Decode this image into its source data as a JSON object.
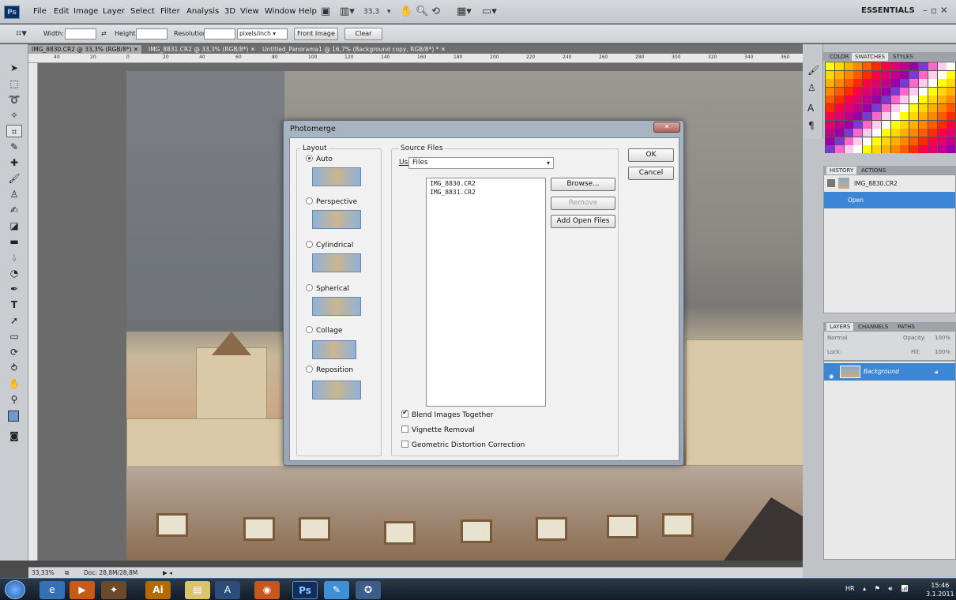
{
  "app": {
    "logo": "Ps",
    "workspace": "ESSENTIALS",
    "window_controls": "– ▫ ✕",
    "zoom": "33,3"
  },
  "menu": [
    "File",
    "Edit",
    "Image",
    "Layer",
    "Select",
    "Filter",
    "Analysis",
    "3D",
    "View",
    "Window",
    "Help"
  ],
  "options": {
    "width_label": "Width:",
    "height_label": "Height:",
    "resolution_label": "Resolution:",
    "units": "pixels/inch",
    "front_image": "Front Image",
    "clear": "Clear"
  },
  "tabs": [
    "IMG_8830.CR2 @ 33,3% (RGB/8*)",
    "IMG_8831.CR2 @ 33,3% (RGB/8*)",
    "Untitled_Panorama1 @ 16,7% (Background copy, RGB/8*) *"
  ],
  "ruler_ticks": [
    "40",
    "20",
    "0",
    "20",
    "40",
    "60",
    "80",
    "100",
    "120",
    "140",
    "160",
    "180",
    "200",
    "220",
    "240",
    "260",
    "280",
    "300",
    "320",
    "340",
    "360"
  ],
  "status": {
    "zoom": "33,33%",
    "doc": "Doc: 28,8M/28,8M"
  },
  "swatch_panel": {
    "tabs": [
      "COLOR",
      "SWATCHES",
      "STYLES"
    ]
  },
  "history_panel": {
    "tabs": [
      "HISTORY",
      "ACTIONS"
    ],
    "source": "IMG_8830.CR2",
    "items": [
      "Open"
    ]
  },
  "layers_panel": {
    "tabs": [
      "LAYERS",
      "CHANNELS",
      "PATHS"
    ],
    "blend_mode": "Normal",
    "opacity_label": "Opacity:",
    "opacity": "100%",
    "lock_label": "Lock:",
    "fill_label": "Fill:",
    "fill": "100%",
    "layers": [
      "Background"
    ]
  },
  "dialog": {
    "title": "Photomerge",
    "close": "✕",
    "layout_title": "Layout",
    "layouts": [
      "Auto",
      "Perspective",
      "Cylindrical",
      "Spherical",
      "Collage",
      "Reposition"
    ],
    "selected_layout": "Auto",
    "source_title": "Source Files",
    "use_label": "Use:",
    "use_value": "Files",
    "files": [
      "IMG_8830.CR2",
      "IMG_8831.CR2"
    ],
    "browse": "Browse...",
    "remove": "Remove",
    "add_open": "Add Open Files",
    "ok": "OK",
    "cancel": "Cancel",
    "options": [
      {
        "label": "Blend Images Together",
        "checked": true
      },
      {
        "label": "Vignette Removal",
        "checked": false
      },
      {
        "label": "Geometric Distortion Correction",
        "checked": false
      }
    ]
  },
  "taskbar": {
    "lang": "HR",
    "time": "15:46",
    "date": "3.1.2011"
  }
}
